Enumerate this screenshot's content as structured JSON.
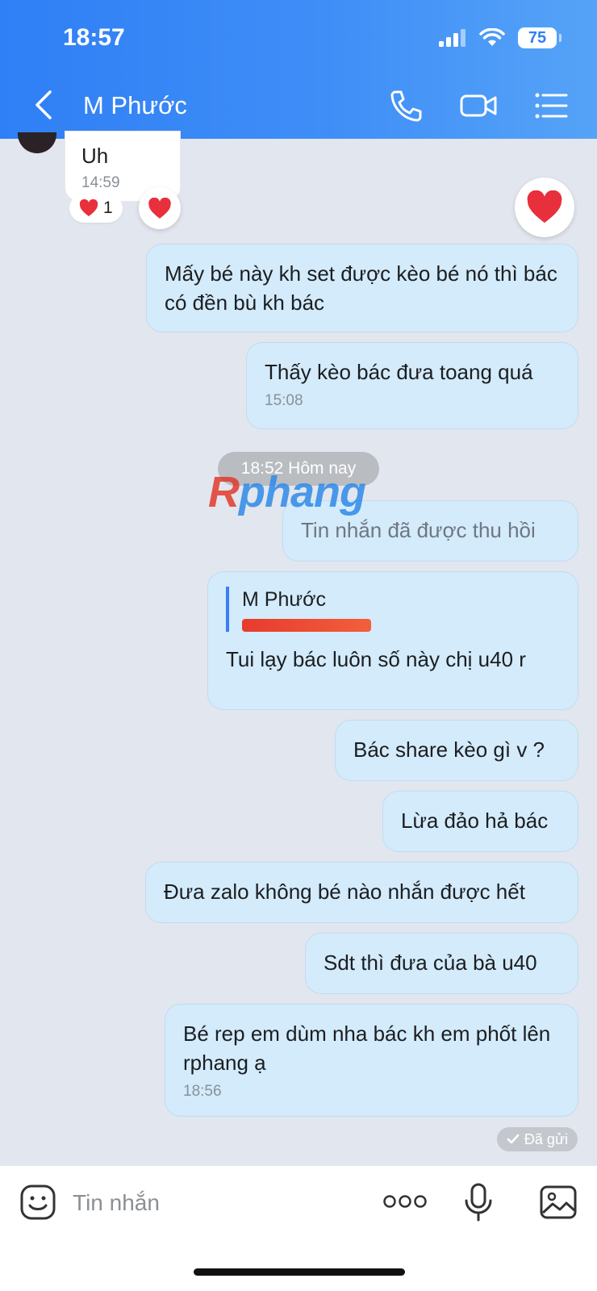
{
  "status_bar": {
    "time": "18:57",
    "battery": "75"
  },
  "nav": {
    "title": "M Phước"
  },
  "messages": {
    "m1": {
      "text": "Uh",
      "time": "14:59",
      "reaction_count": "1"
    },
    "m2": {
      "text": "Mấy bé này kh set được kèo bé nó thì bác có đền bù kh bác"
    },
    "m3": {
      "text": "Thấy kèo bác đưa toang quá",
      "time": "15:08"
    },
    "date_divider": "18:52 Hôm nay",
    "m4": {
      "text": "Tin nhắn đã được thu hồi"
    },
    "m5": {
      "quote_name": "M Phước",
      "text": "Tui lạy bác luôn số này chị u40 r"
    },
    "m6": {
      "text": "Bác share kèo gì v ?"
    },
    "m7": {
      "text": "Lừa đảo hả bác"
    },
    "m8": {
      "text": "Đưa zalo không bé nào nhắn được hết"
    },
    "m9": {
      "text": "Sdt thì đưa của bà u40"
    },
    "m10": {
      "text": "Bé rep em dùm nha bác kh em phốt lên rphang ạ",
      "time": "18:56"
    },
    "sent_status": "Đã gửi"
  },
  "watermark": {
    "text": "Rphang"
  },
  "input": {
    "placeholder": "Tin nhắn"
  },
  "colors": {
    "header": "#3f8ef7",
    "sent_bubble": "#d3ebfb",
    "background": "#e2e6ee",
    "heart": "#e8303c"
  },
  "icons": [
    "back-icon",
    "phone-icon",
    "video-call-icon",
    "menu-icon",
    "heart-icon",
    "sticker-icon",
    "more-icon",
    "mic-icon",
    "image-icon",
    "check-icon"
  ]
}
